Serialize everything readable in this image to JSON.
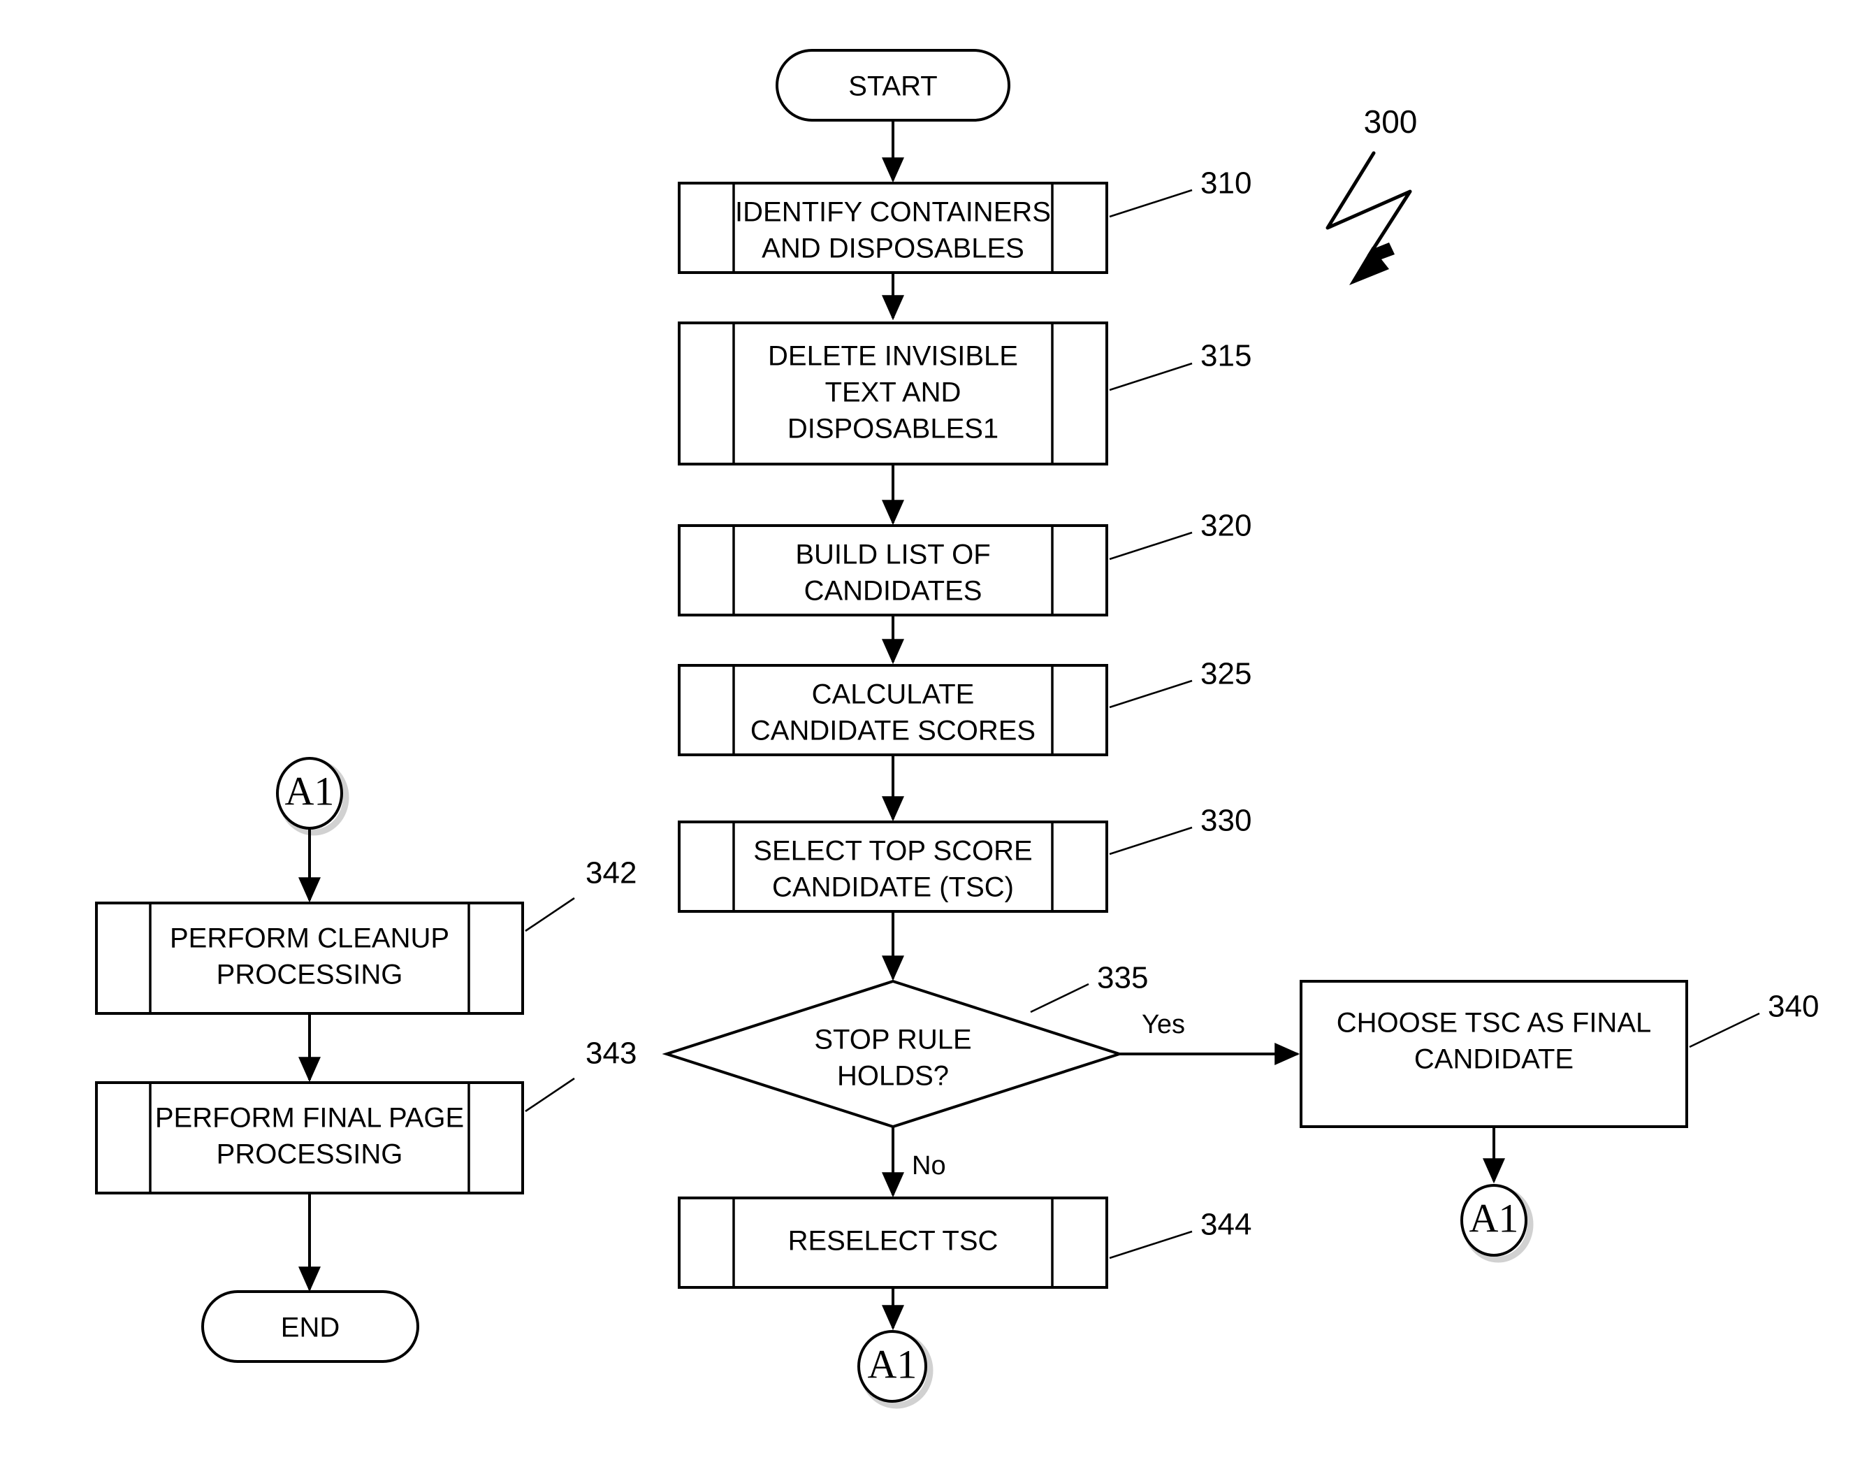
{
  "figure": {
    "number": "300",
    "type": "flowchart"
  },
  "chart_data": {
    "type": "diagram",
    "title": "300",
    "nodes": [
      {
        "id": "start",
        "ref": "",
        "shape": "terminator",
        "label": "START"
      },
      {
        "id": "n310",
        "ref": "310",
        "shape": "predefined-process",
        "label": "IDENTIFY CONTAINERS AND DISPOSABLES"
      },
      {
        "id": "n315",
        "ref": "315",
        "shape": "predefined-process",
        "label": "DELETE INVISIBLE TEXT AND DISPOSABLES1"
      },
      {
        "id": "n320",
        "ref": "320",
        "shape": "predefined-process",
        "label": "BUILD LIST OF CANDIDATES"
      },
      {
        "id": "n325",
        "ref": "325",
        "shape": "predefined-process",
        "label": "CALCULATE CANDIDATE SCORES"
      },
      {
        "id": "n330",
        "ref": "330",
        "shape": "predefined-process",
        "label": "SELECT TOP SCORE CANDIDATE (TSC)"
      },
      {
        "id": "n335",
        "ref": "335",
        "shape": "decision",
        "label": "STOP RULE HOLDS?"
      },
      {
        "id": "n340",
        "ref": "340",
        "shape": "process",
        "label": "CHOOSE TSC AS FINAL CANDIDATE"
      },
      {
        "id": "n344",
        "ref": "344",
        "shape": "predefined-process",
        "label": "RESELECT TSC"
      },
      {
        "id": "n342",
        "ref": "342",
        "shape": "predefined-process",
        "label": "PERFORM CLEANUP PROCESSING"
      },
      {
        "id": "n343",
        "ref": "343",
        "shape": "predefined-process",
        "label": "PERFORM FINAL PAGE PROCESSING"
      },
      {
        "id": "end",
        "ref": "",
        "shape": "terminator",
        "label": "END"
      },
      {
        "id": "conn-a1-left",
        "ref": "",
        "shape": "connector",
        "label": "A1"
      },
      {
        "id": "conn-a1-bottom",
        "ref": "",
        "shape": "connector",
        "label": "A1"
      },
      {
        "id": "conn-a1-right",
        "ref": "",
        "shape": "connector",
        "label": "A1"
      }
    ],
    "edges": [
      {
        "from": "start",
        "to": "n310",
        "label": ""
      },
      {
        "from": "n310",
        "to": "n315",
        "label": ""
      },
      {
        "from": "n315",
        "to": "n320",
        "label": ""
      },
      {
        "from": "n320",
        "to": "n325",
        "label": ""
      },
      {
        "from": "n325",
        "to": "n330",
        "label": ""
      },
      {
        "from": "n330",
        "to": "n335",
        "label": ""
      },
      {
        "from": "n335",
        "to": "n340",
        "label": "Yes"
      },
      {
        "from": "n335",
        "to": "n344",
        "label": "No"
      },
      {
        "from": "n344",
        "to": "conn-a1-bottom",
        "label": ""
      },
      {
        "from": "n340",
        "to": "conn-a1-right",
        "label": ""
      },
      {
        "from": "conn-a1-left",
        "to": "n342",
        "label": ""
      },
      {
        "from": "n342",
        "to": "n343",
        "label": ""
      },
      {
        "from": "n343",
        "to": "end",
        "label": ""
      }
    ]
  },
  "nodes": {
    "start": {
      "label": "START"
    },
    "n310": {
      "line1": "IDENTIFY CONTAINERS",
      "line2": "AND DISPOSABLES",
      "ref": "310"
    },
    "n315": {
      "line1": "DELETE INVISIBLE",
      "line2": "TEXT AND",
      "line3": "DISPOSABLES1",
      "ref": "315"
    },
    "n320": {
      "line1": "BUILD LIST OF",
      "line2": "CANDIDATES",
      "ref": "320"
    },
    "n325": {
      "line1": "CALCULATE",
      "line2": "CANDIDATE SCORES",
      "ref": "325"
    },
    "n330": {
      "line1": "SELECT TOP SCORE",
      "line2": "CANDIDATE (TSC)",
      "ref": "330"
    },
    "n335": {
      "line1": "STOP RULE",
      "line2": "HOLDS?",
      "ref": "335"
    },
    "n340": {
      "line1": "CHOOSE TSC AS FINAL",
      "line2": "CANDIDATE",
      "ref": "340"
    },
    "n344": {
      "line1": "RESELECT TSC",
      "ref": "344"
    },
    "n342": {
      "line1": "PERFORM CLEANUP",
      "line2": "PROCESSING",
      "ref": "342"
    },
    "n343": {
      "line1": "PERFORM FINAL PAGE",
      "line2": "PROCESSING",
      "ref": "343"
    },
    "end": {
      "label": "END"
    },
    "connector_left": {
      "label": "A1"
    },
    "connector_bottom": {
      "label": "A1"
    },
    "connector_right": {
      "label": "A1"
    }
  },
  "edge_labels": {
    "yes": "Yes",
    "no": "No"
  },
  "colors": {
    "stroke": "#000000",
    "fill": "#ffffff",
    "shadow": "#b8b8b8"
  }
}
